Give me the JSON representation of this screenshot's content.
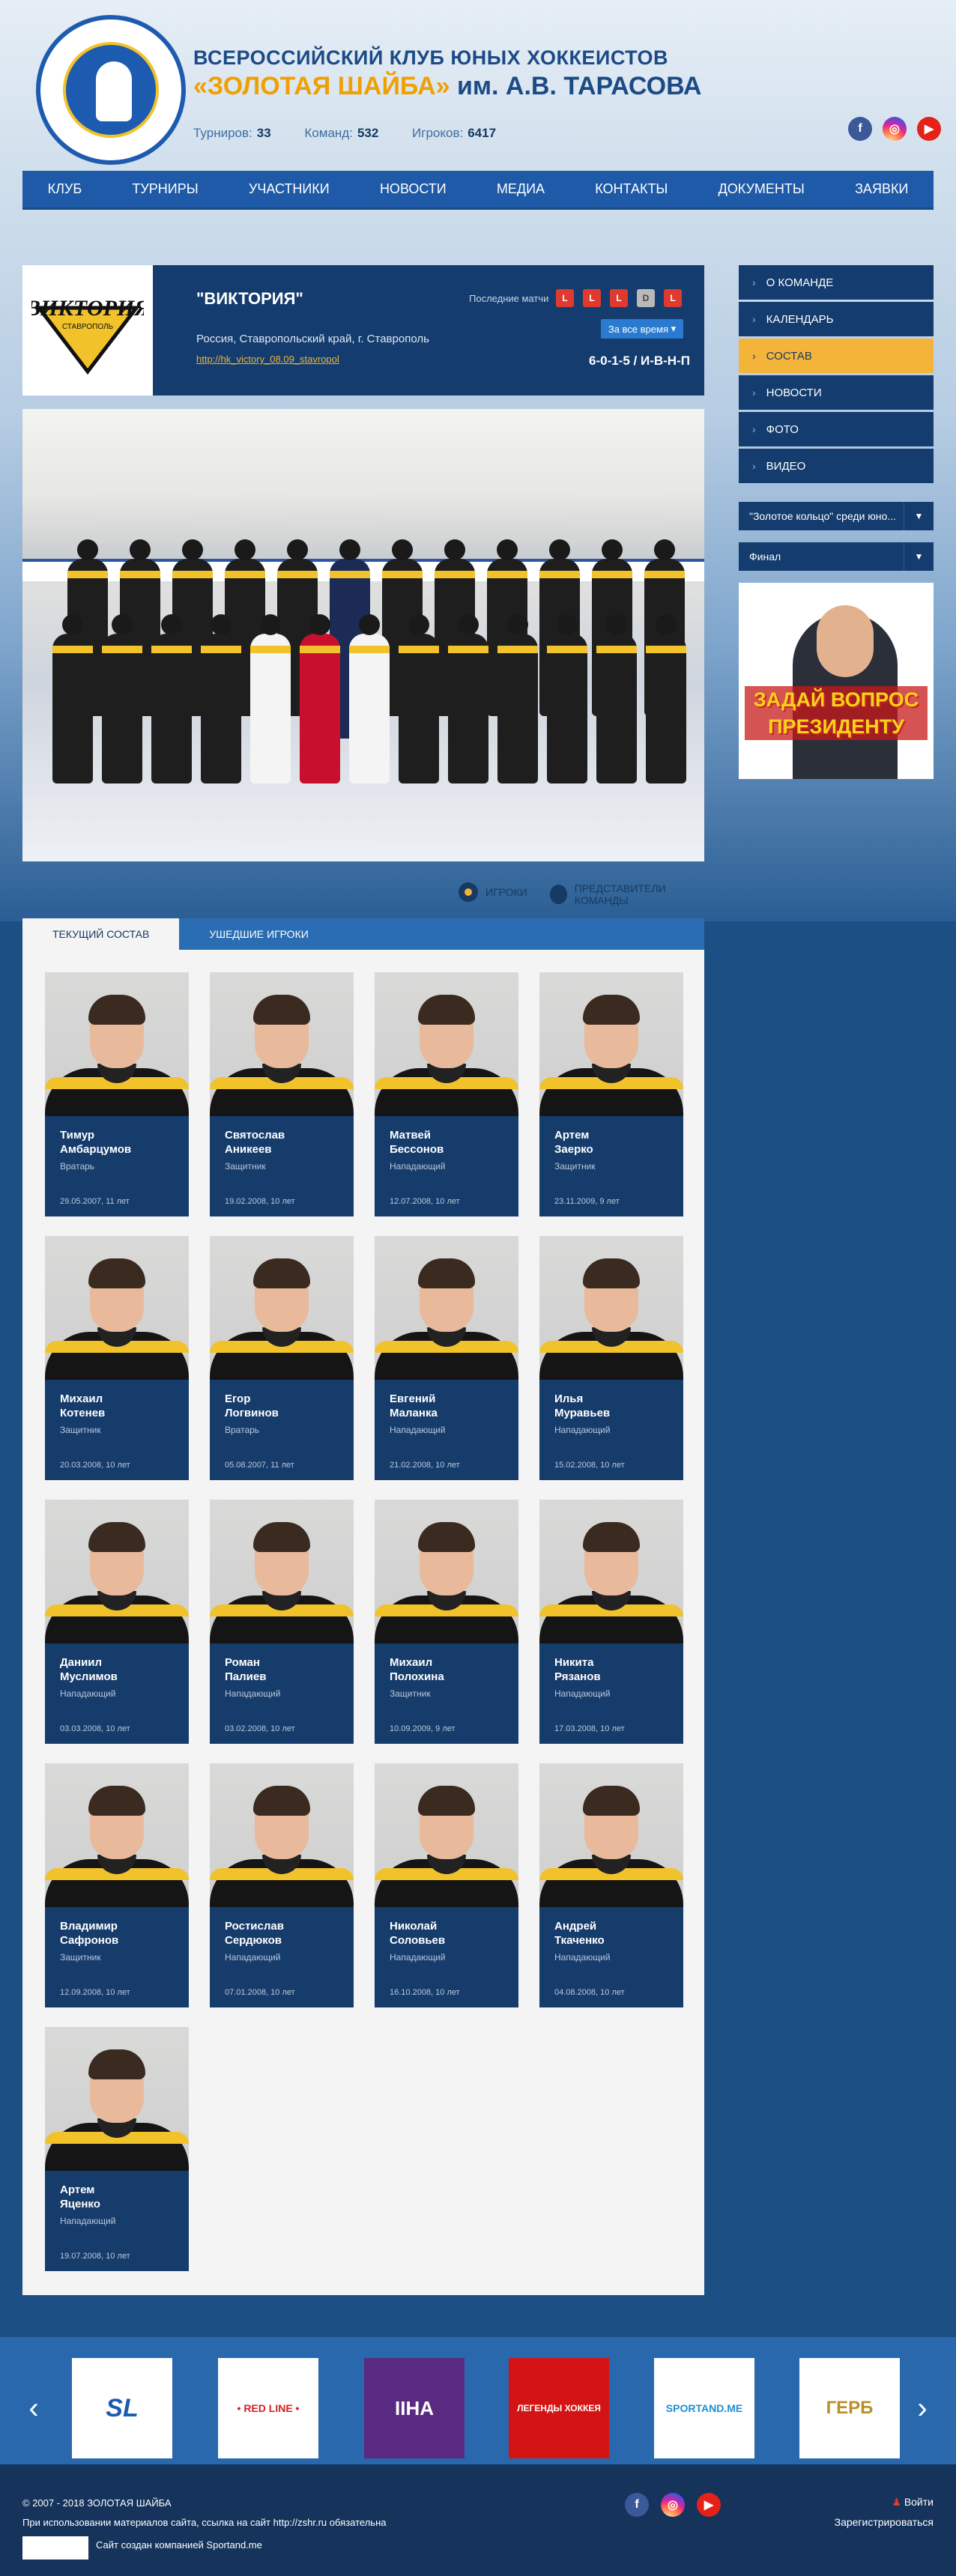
{
  "header": {
    "title_line1": "ВСЕРОССИЙСКИЙ КЛУБ ЮНЫХ ХОККЕИСТОВ",
    "title_gold": "«ЗОЛОТАЯ ШАЙБА»",
    "title_rest": " им. А.В. ТАРАСОВА",
    "logo_text": "ВСЕРОССИЙСКИЙ КЛУБ ЮНЫХ ХОККЕИСТОВ ЗОЛОТАЯ ШАЙБА",
    "stats": [
      {
        "label": "Турниров:",
        "value": "33"
      },
      {
        "label": "Команд:",
        "value": "532"
      },
      {
        "label": "Игроков:",
        "value": "6417"
      }
    ],
    "social": [
      "f",
      "◎",
      "▶"
    ]
  },
  "nav": [
    "КЛУБ",
    "ТУРНИРЫ",
    "УЧАСТНИКИ",
    "НОВОСТИ",
    "МЕДИА",
    "КОНТАКТЫ",
    "ДОКУМЕНТЫ",
    "ЗАЯВКИ"
  ],
  "team": {
    "name": "\"ВИКТОРИЯ\"",
    "logo_text": "ВИКТОРИЯ",
    "logo_sub": "СТАВРОПОЛЬ",
    "location": "Россия, Ставропольский край, г. Ставрополь",
    "site": "http://hk_victory_08.09_stavropol",
    "last_label": "Последние матчи",
    "last_games": [
      "L",
      "L",
      "L",
      "D",
      "L"
    ],
    "period": "За все время",
    "record": "6-0-1-5 / И-В-Н-П"
  },
  "filters": {
    "players": "ИГРОКИ",
    "staff": "ПРЕДСТАВИТЕЛИ КОМАНДЫ"
  },
  "tabs": [
    "ТЕКУЩИЙ СОСТАВ",
    "УШЕДШИЕ ИГРОКИ"
  ],
  "players": [
    {
      "first": "Тимур",
      "last": "Амбарцумов",
      "pos": "Вратарь",
      "dob": "29.05.2007,   11 лет"
    },
    {
      "first": "Святослав",
      "last": "Аникеев",
      "pos": "Защитник",
      "dob": "19.02.2008,   10 лет"
    },
    {
      "first": "Матвей",
      "last": "Бессонов",
      "pos": "Нападающий",
      "dob": "12.07.2008,   10 лет"
    },
    {
      "first": "Артем",
      "last": "Заерко",
      "pos": "Защитник",
      "dob": "23.11.2009,   9 лет"
    },
    {
      "first": "Михаил",
      "last": "Котенев",
      "pos": "Защитник",
      "dob": "20.03.2008,   10 лет"
    },
    {
      "first": "Егор",
      "last": "Логвинов",
      "pos": "Вратарь",
      "dob": "05.08.2007,   11 лет"
    },
    {
      "first": "Евгений",
      "last": "Маланка",
      "pos": "Нападающий",
      "dob": "21.02.2008,   10 лет"
    },
    {
      "first": "Илья",
      "last": "Муравьев",
      "pos": "Нападающий",
      "dob": "15.02.2008,   10 лет"
    },
    {
      "first": "Даниил",
      "last": "Муслимов",
      "pos": "Нападающий",
      "dob": "03.03.2008,   10 лет"
    },
    {
      "first": "Роман",
      "last": "Палиев",
      "pos": "Нападающий",
      "dob": "03.02.2008,   10 лет"
    },
    {
      "first": "Михаил",
      "last": "Полохина",
      "pos": "Защитник",
      "dob": "10.09.2009,   9 лет"
    },
    {
      "first": "Никита",
      "last": "Рязанов",
      "pos": "Нападающий",
      "dob": "17.03.2008,   10 лет"
    },
    {
      "first": "Владимир",
      "last": "Сафронов",
      "pos": "Защитник",
      "dob": "12.09.2008,   10 лет"
    },
    {
      "first": "Ростислав",
      "last": "Сердюков",
      "pos": "Нападающий",
      "dob": "07.01.2008,   10 лет"
    },
    {
      "first": "Николай",
      "last": "Соловьев",
      "pos": "Нападающий",
      "dob": "16.10.2008,   10 лет"
    },
    {
      "first": "Андрей",
      "last": "Ткаченко",
      "pos": "Нападающий",
      "dob": "04.08.2008,   10 лет"
    },
    {
      "first": "Артем",
      "last": "Яценко",
      "pos": "Нападающий",
      "dob": "19.07.2008,   10 лет"
    }
  ],
  "sidebar": {
    "menu": [
      "О КОМАНДЕ",
      "КАЛЕНДАРЬ",
      "СОСТАВ",
      "НОВОСТИ",
      "ФОТО",
      "ВИДЕО"
    ],
    "active": "СОСТАВ",
    "select1": "\"Золотое кольцо\" среди юно...",
    "select2": "Финал",
    "banner_text": "ЗАДАЙ ВОПРОС ПРЕЗИДЕНТУ"
  },
  "partners": [
    "SL",
    "• RED LINE •",
    "IIHA",
    "ЛЕГЕНДЫ ХОККЕЯ",
    "SPORTAND.ME",
    "ГЕРБ"
  ],
  "footer": {
    "copyright": "© 2007 - 2018 ЗОЛОТАЯ ШАЙБА",
    "note_pre": "При использовании материалов сайта, ссылка на сайт ",
    "note_link": "http://zshr.ru",
    "note_post": " обязательна",
    "made_pre": "Сайт создан компанией ",
    "made_link": "Sportand.me",
    "login": "Войти",
    "register": "Зарегистрироваться"
  },
  "colors": {
    "brand_blue": "#1e5aa8",
    "dark_blue": "#143c6e",
    "gold": "#f4b43a",
    "loss_red": "#e03a2f"
  }
}
